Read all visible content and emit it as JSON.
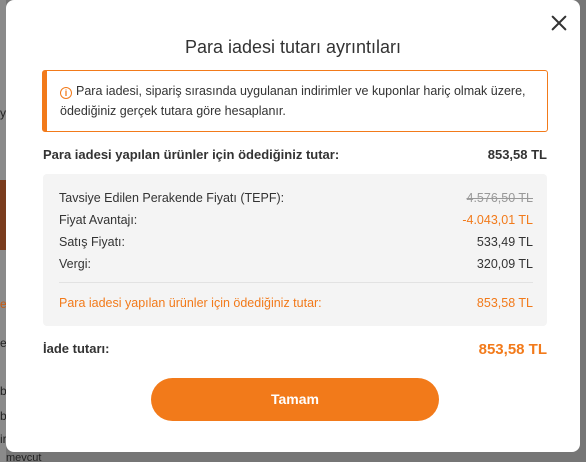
{
  "background": {
    "fragments": [
      "y",
      "e",
      "e",
      "ba",
      "ba",
      "ir",
      "mevcut"
    ]
  },
  "modal": {
    "title": "Para iadesi tutarı ayrıntıları",
    "info_icon": "info-circle-icon",
    "info_text": "Para iadesi, sipariş sırasında uygulanan indirimler ve kuponlar hariç olmak üzere, ödediğiniz gerçek tutara göre hesaplanır.",
    "paid_label": "Para iadesi yapılan ürünler için ödediğiniz tutar:",
    "paid_value": "853,58 TL",
    "details": {
      "rows": [
        {
          "label": "Tavsiye Edilen Perakende Fiyatı (TEPF):",
          "value": "4.576,50 TL"
        },
        {
          "label": "Fiyat Avantajı:",
          "value": "-4.043,01 TL"
        },
        {
          "label": "Satış Fiyatı:",
          "value": "533,49 TL"
        },
        {
          "label": "Vergi:",
          "value": "320,09 TL"
        }
      ],
      "summary_label": "Para iadesi yapılan ürünler için ödediğiniz tutar:",
      "summary_value": "853,58 TL"
    },
    "refund_label": "İade tutarı:",
    "refund_value": "853,58 TL",
    "confirm_button": "Tamam"
  },
  "colors": {
    "accent": "#f27a1a",
    "panel": "#f4f4f4"
  }
}
